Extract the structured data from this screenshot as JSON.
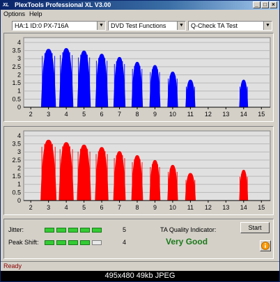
{
  "window": {
    "title": "PlexTools Professional XL V3.00",
    "logo_text": "XL",
    "accent": "#0a246a"
  },
  "menu": {
    "options": "Options",
    "help": "Help"
  },
  "toolbar": {
    "drive_select": "HA:1 ID:0  PX-716A",
    "function_select": "DVD Test Functions",
    "test_select": "Q-Check TA Test"
  },
  "charts": {
    "x_ticks": [
      "2",
      "3",
      "4",
      "5",
      "6",
      "7",
      "8",
      "9",
      "10",
      "11",
      "12",
      "13",
      "14",
      "15"
    ],
    "y_ticks": [
      "4",
      "3.5",
      "3",
      "2.5",
      "2",
      "1.5",
      "1",
      "0.5",
      "0"
    ]
  },
  "chart_data": [
    {
      "type": "area",
      "color": "#0000ff",
      "xlim": [
        1.6,
        15.5
      ],
      "ylim": [
        0,
        4.3
      ],
      "x_ticks": [
        2,
        3,
        4,
        5,
        6,
        7,
        8,
        9,
        10,
        11,
        12,
        13,
        14,
        15
      ],
      "y_ticks": [
        0,
        0.5,
        1,
        1.5,
        2,
        2.5,
        3,
        3.5,
        4
      ],
      "grid": true,
      "peaks": [
        {
          "x": 3,
          "height": 3.6,
          "width": 0.42
        },
        {
          "x": 4,
          "height": 3.65,
          "width": 0.4
        },
        {
          "x": 5,
          "height": 3.5,
          "width": 0.38
        },
        {
          "x": 6,
          "height": 3.3,
          "width": 0.36
        },
        {
          "x": 7,
          "height": 3.1,
          "width": 0.34
        },
        {
          "x": 8,
          "height": 2.8,
          "width": 0.32
        },
        {
          "x": 9,
          "height": 2.6,
          "width": 0.31
        },
        {
          "x": 10,
          "height": 2.2,
          "width": 0.3
        },
        {
          "x": 11,
          "height": 1.7,
          "width": 0.28
        },
        {
          "x": 14,
          "height": 1.7,
          "width": 0.25
        }
      ]
    },
    {
      "type": "area",
      "color": "#ff0000",
      "xlim": [
        1.6,
        15.5
      ],
      "ylim": [
        0,
        4.3
      ],
      "x_ticks": [
        2,
        3,
        4,
        5,
        6,
        7,
        8,
        9,
        10,
        11,
        12,
        13,
        14,
        15
      ],
      "y_ticks": [
        0,
        0.5,
        1,
        1.5,
        2,
        2.5,
        3,
        3.5,
        4
      ],
      "grid": true,
      "peaks": [
        {
          "x": 3,
          "height": 3.75,
          "width": 0.45
        },
        {
          "x": 4,
          "height": 3.6,
          "width": 0.42
        },
        {
          "x": 5,
          "height": 3.45,
          "width": 0.4
        },
        {
          "x": 6,
          "height": 3.3,
          "width": 0.38
        },
        {
          "x": 7,
          "height": 3.05,
          "width": 0.35
        },
        {
          "x": 8,
          "height": 2.8,
          "width": 0.33
        },
        {
          "x": 9,
          "height": 2.5,
          "width": 0.31
        },
        {
          "x": 10,
          "height": 2.2,
          "width": 0.3
        },
        {
          "x": 11,
          "height": 1.7,
          "width": 0.3
        },
        {
          "x": 14,
          "height": 1.9,
          "width": 0.25
        }
      ]
    }
  ],
  "quality": {
    "jitter_label": "Jitter:",
    "jitter_value": "5",
    "jitter_level": 5,
    "peak_shift_label": "Peak Shift:",
    "peak_shift_value": "4",
    "peak_shift_level": 4,
    "max_level": 5,
    "ta_label": "TA Quality Indicator:",
    "ta_value": "Very Good",
    "ta_color": "#1a7a1a",
    "start_label": "Start",
    "info_icon": "info-icon"
  },
  "status": {
    "text": "Ready"
  },
  "image_caption": "495x480  49kb  JPEG"
}
